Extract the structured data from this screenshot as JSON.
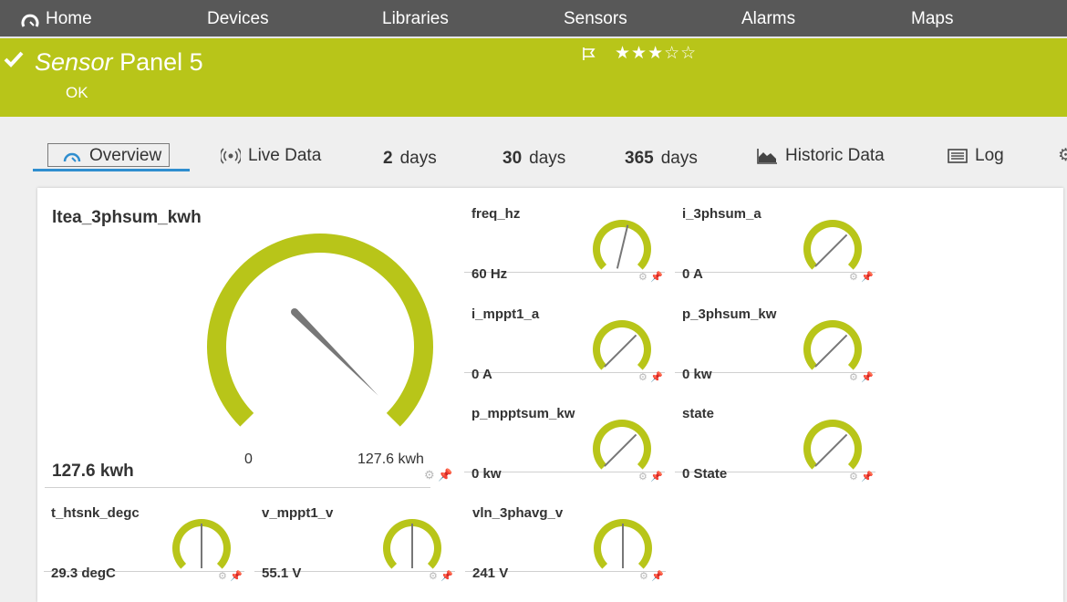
{
  "nav": {
    "home": "Home",
    "items": [
      "Devices",
      "Libraries",
      "Sensors",
      "Alarms",
      "Maps"
    ]
  },
  "header": {
    "title_italic": "Sensor",
    "title_rest": " Panel 5",
    "status": "OK",
    "stars": "★★★☆☆",
    "rating": 3
  },
  "tabs": {
    "overview": "Overview",
    "live": "Live Data",
    "d2_num": "2",
    "d2_unit": "days",
    "d30_num": "30",
    "d30_unit": "days",
    "d365_num": "365",
    "d365_unit": "days",
    "historic": "Historic Data",
    "log": "Log"
  },
  "main": {
    "name": "ltea_3phsum_kwh",
    "value": "127.6 kwh",
    "min": "0",
    "max": "127.6 kwh",
    "level": 1.0
  },
  "tiles": [
    {
      "name": "freq_hz",
      "value": "60 Hz",
      "level": 0.55
    },
    {
      "name": "i_3phsum_a",
      "value": "0 A",
      "level": 0.0
    },
    {
      "name": "i_mppt1_a",
      "value": "0 A",
      "level": 0.0
    },
    {
      "name": "p_3phsum_kw",
      "value": "0 kw",
      "level": 0.0
    },
    {
      "name": "p_mpptsum_kw",
      "value": "0 kw",
      "level": 0.0
    },
    {
      "name": "state",
      "value": "0 State",
      "level": 0.0
    },
    {
      "name": "t_htsnk_degc",
      "value": "29.3 degC",
      "level": 0.5
    },
    {
      "name": "v_mppt1_v",
      "value": "55.1 V",
      "level": 0.5
    },
    {
      "name": "vln_3phavg_v",
      "value": "241 V",
      "level": 0.5
    }
  ],
  "colors": {
    "accent": "#b8c519",
    "nav_bg": "#585858",
    "tab_active": "#2f8ecf",
    "needle": "#777777"
  }
}
